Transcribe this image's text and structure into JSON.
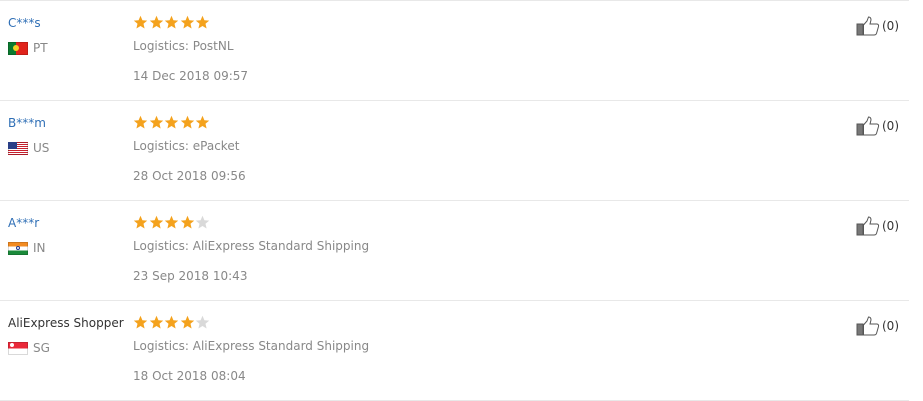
{
  "colors": {
    "name_link": "#2f6fb6",
    "star_filled": "#f4a21d",
    "star_empty": "#d9d9d9",
    "muted_text": "#888888"
  },
  "reviews": [
    {
      "name": "C***s",
      "country_code": "PT",
      "flag_icon": "portugal-flag-icon",
      "rating": 5,
      "max_rating": 5,
      "logistics": "Logistics: PostNL",
      "date": "14 Dec 2018 09:57",
      "helpful_count": "(0)"
    },
    {
      "name": "B***m",
      "country_code": "US",
      "flag_icon": "united-states-flag-icon",
      "rating": 5,
      "max_rating": 5,
      "logistics": "Logistics: ePacket",
      "date": "28 Oct 2018 09:56",
      "helpful_count": "(0)"
    },
    {
      "name": "A***r",
      "country_code": "IN",
      "flag_icon": "india-flag-icon",
      "rating": 4,
      "max_rating": 5,
      "logistics": "Logistics: AliExpress Standard Shipping",
      "date": "23 Sep 2018 10:43",
      "helpful_count": "(0)"
    },
    {
      "name": "AliExpress Shopper",
      "country_code": "SG",
      "flag_icon": "singapore-flag-icon",
      "rating": 4,
      "max_rating": 5,
      "logistics": "Logistics: AliExpress Standard Shipping",
      "date": "18 Oct 2018 08:04",
      "helpful_count": "(0)"
    }
  ]
}
